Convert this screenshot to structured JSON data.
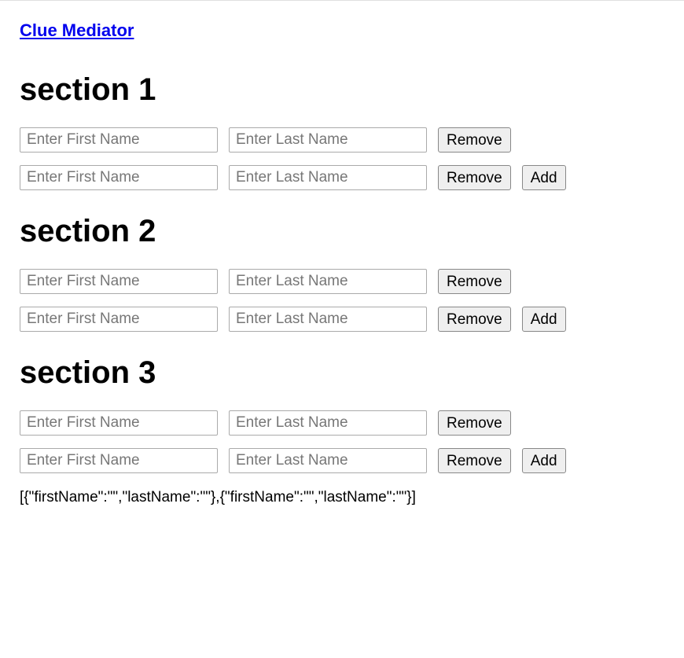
{
  "header": {
    "link_text": "Clue Mediator"
  },
  "sections": [
    {
      "heading": "section 1",
      "rows": [
        {
          "first_name_placeholder": "Enter First Name",
          "first_name_value": "",
          "last_name_placeholder": "Enter Last Name",
          "last_name_value": "",
          "remove_label": "Remove",
          "has_add": false
        },
        {
          "first_name_placeholder": "Enter First Name",
          "first_name_value": "",
          "last_name_placeholder": "Enter Last Name",
          "last_name_value": "",
          "remove_label": "Remove",
          "has_add": true,
          "add_label": "Add"
        }
      ]
    },
    {
      "heading": "section 2",
      "rows": [
        {
          "first_name_placeholder": "Enter First Name",
          "first_name_value": "",
          "last_name_placeholder": "Enter Last Name",
          "last_name_value": "",
          "remove_label": "Remove",
          "has_add": false
        },
        {
          "first_name_placeholder": "Enter First Name",
          "first_name_value": "",
          "last_name_placeholder": "Enter Last Name",
          "last_name_value": "",
          "remove_label": "Remove",
          "has_add": true,
          "add_label": "Add"
        }
      ]
    },
    {
      "heading": "section 3",
      "rows": [
        {
          "first_name_placeholder": "Enter First Name",
          "first_name_value": "",
          "last_name_placeholder": "Enter Last Name",
          "last_name_value": "",
          "remove_label": "Remove",
          "has_add": false
        },
        {
          "first_name_placeholder": "Enter First Name",
          "first_name_value": "",
          "last_name_placeholder": "Enter Last Name",
          "last_name_value": "",
          "remove_label": "Remove",
          "has_add": true,
          "add_label": "Add"
        }
      ]
    }
  ],
  "json_output": "[{\"firstName\":\"\",\"lastName\":\"\"},{\"firstName\":\"\",\"lastName\":\"\"}]"
}
